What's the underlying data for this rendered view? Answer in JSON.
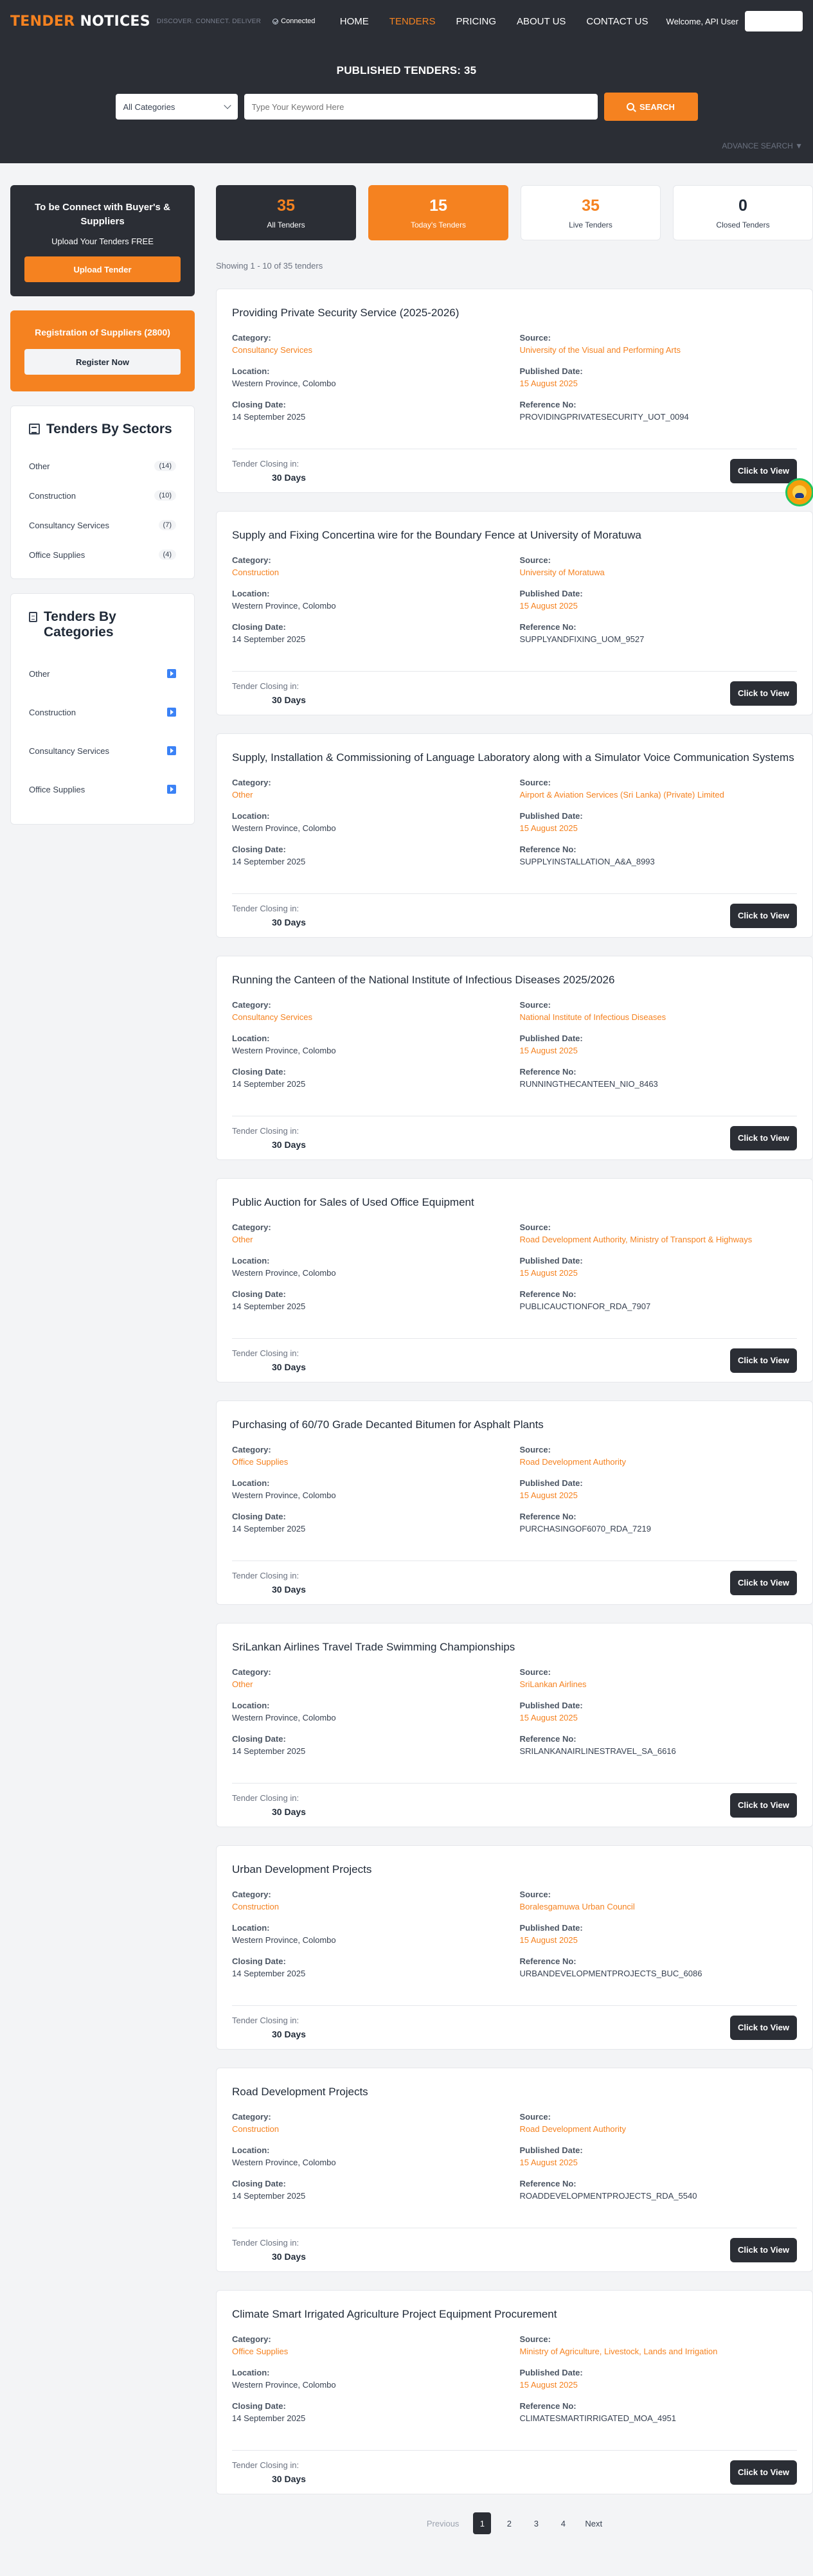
{
  "header": {
    "logo_part1": "TENDER",
    "logo_part2": "NOTICES",
    "tagline": "DISCOVER. CONNECT. DELIVER",
    "connection_status": "Connected",
    "nav": [
      {
        "label": "HOME",
        "active": false
      },
      {
        "label": "TENDERS",
        "active": true
      },
      {
        "label": "PRICING",
        "active": false
      },
      {
        "label": "ABOUT US",
        "active": false
      },
      {
        "label": "CONTACT US",
        "active": false
      }
    ],
    "welcome": "Welcome, API User"
  },
  "hero": {
    "title": "PUBLISHED TENDERS: 35",
    "category_select": "All Categories",
    "keyword_placeholder": "Type Your Keyword Here",
    "search_label": "SEARCH",
    "advance_search": "ADVANCE SEARCH ▼"
  },
  "sidebar": {
    "connect_title": "To be Connect with Buyer's & Suppliers",
    "connect_sub": "Upload Your Tenders FREE",
    "upload_label": "Upload Tender",
    "registration_title": "Registration of Suppliers (2800)",
    "register_label": "Register Now",
    "sectors_title": "Tenders By Sectors",
    "sectors": [
      {
        "name": "Other",
        "count": "(14)"
      },
      {
        "name": "Construction",
        "count": "(10)"
      },
      {
        "name": "Consultancy Services",
        "count": "(7)"
      },
      {
        "name": "Office Supplies",
        "count": "(4)"
      }
    ],
    "categories_title": "Tenders By Categories",
    "categories": [
      {
        "name": "Other"
      },
      {
        "name": "Construction"
      },
      {
        "name": "Consultancy Services"
      },
      {
        "name": "Office Supplies"
      }
    ]
  },
  "stats": [
    {
      "value": "35",
      "label": "All Tenders"
    },
    {
      "value": "15",
      "label": "Today's Tenders"
    },
    {
      "value": "35",
      "label": "Live Tenders"
    },
    {
      "value": "0",
      "label": "Closed Tenders"
    }
  ],
  "showing": "Showing 1 - 10 of 35 tenders",
  "labels": {
    "category": "Category:",
    "source": "Source:",
    "location": "Location:",
    "published": "Published Date:",
    "closing": "Closing Date:",
    "reference": "Reference No:",
    "closing_in": "Tender Closing in:",
    "view": "Click to View"
  },
  "tenders": [
    {
      "title": "Providing Private Security Service (2025-2026)",
      "category": "Consultancy Services",
      "source": "University of the Visual and Performing Arts",
      "location": "Western Province, Colombo",
      "published": "15 August 2025",
      "closing": "14 September 2025",
      "reference": "PROVIDINGPRIVATESECURITY_UOT_0094",
      "days": "30 Days"
    },
    {
      "title": "Supply and Fixing Concertina wire for the Boundary Fence at University of Moratuwa",
      "category": "Construction",
      "source": "University of Moratuwa",
      "location": "Western Province, Colombo",
      "published": "15 August 2025",
      "closing": "14 September 2025",
      "reference": "SUPPLYANDFIXING_UOM_9527",
      "days": "30 Days"
    },
    {
      "title": "Supply, Installation & Commissioning of Language Laboratory along with a Simulator Voice Communication Systems",
      "category": "Other",
      "source": "Airport & Aviation Services (Sri Lanka) (Private) Limited",
      "location": "Western Province, Colombo",
      "published": "15 August 2025",
      "closing": "14 September 2025",
      "reference": "SUPPLYINSTALLATION_A&A_8993",
      "days": "30 Days"
    },
    {
      "title": "Running the Canteen of the National Institute of Infectious Diseases 2025/2026",
      "category": "Consultancy Services",
      "source": "National Institute of Infectious Diseases",
      "location": "Western Province, Colombo",
      "published": "15 August 2025",
      "closing": "14 September 2025",
      "reference": "RUNNINGTHECANTEEN_NIO_8463",
      "days": "30 Days"
    },
    {
      "title": "Public Auction for Sales of Used Office Equipment",
      "category": "Other",
      "source": "Road Development Authority, Ministry of Transport & Highways",
      "location": "Western Province, Colombo",
      "published": "15 August 2025",
      "closing": "14 September 2025",
      "reference": "PUBLICAUCTIONFOR_RDA_7907",
      "days": "30 Days"
    },
    {
      "title": "Purchasing of 60/70 Grade Decanted Bitumen for Asphalt Plants",
      "category": "Office Supplies",
      "source": "Road Development Authority",
      "location": "Western Province, Colombo",
      "published": "15 August 2025",
      "closing": "14 September 2025",
      "reference": "PURCHASINGOF6070_RDA_7219",
      "days": "30 Days"
    },
    {
      "title": "SriLankan Airlines Travel Trade Swimming Championships",
      "category": "Other",
      "source": "SriLankan Airlines",
      "location": "Western Province, Colombo",
      "published": "15 August 2025",
      "closing": "14 September 2025",
      "reference": "SRILANKANAIRLINESTRAVEL_SA_6616",
      "days": "30 Days"
    },
    {
      "title": "Urban Development Projects",
      "category": "Construction",
      "source": "Boralesgamuwa Urban Council",
      "location": "Western Province, Colombo",
      "published": "15 August 2025",
      "closing": "14 September 2025",
      "reference": "URBANDEVELOPMENTPROJECTS_BUC_6086",
      "days": "30 Days"
    },
    {
      "title": "Road Development Projects",
      "category": "Construction",
      "source": "Road Development Authority",
      "location": "Western Province, Colombo",
      "published": "15 August 2025",
      "closing": "14 September 2025",
      "reference": "ROADDEVELOPMENTPROJECTS_RDA_5540",
      "days": "30 Days"
    },
    {
      "title": "Climate Smart Irrigated Agriculture Project Equipment Procurement",
      "category": "Office Supplies",
      "source": "Ministry of Agriculture, Livestock, Lands and Irrigation",
      "location": "Western Province, Colombo",
      "published": "15 August 2025",
      "closing": "14 September 2025",
      "reference": "CLIMATESMARTIRRIGATED_MOA_4951",
      "days": "30 Days"
    }
  ],
  "pagination": {
    "previous": "Previous",
    "pages": [
      "1",
      "2",
      "3",
      "4"
    ],
    "current": "1",
    "next": "Next"
  }
}
